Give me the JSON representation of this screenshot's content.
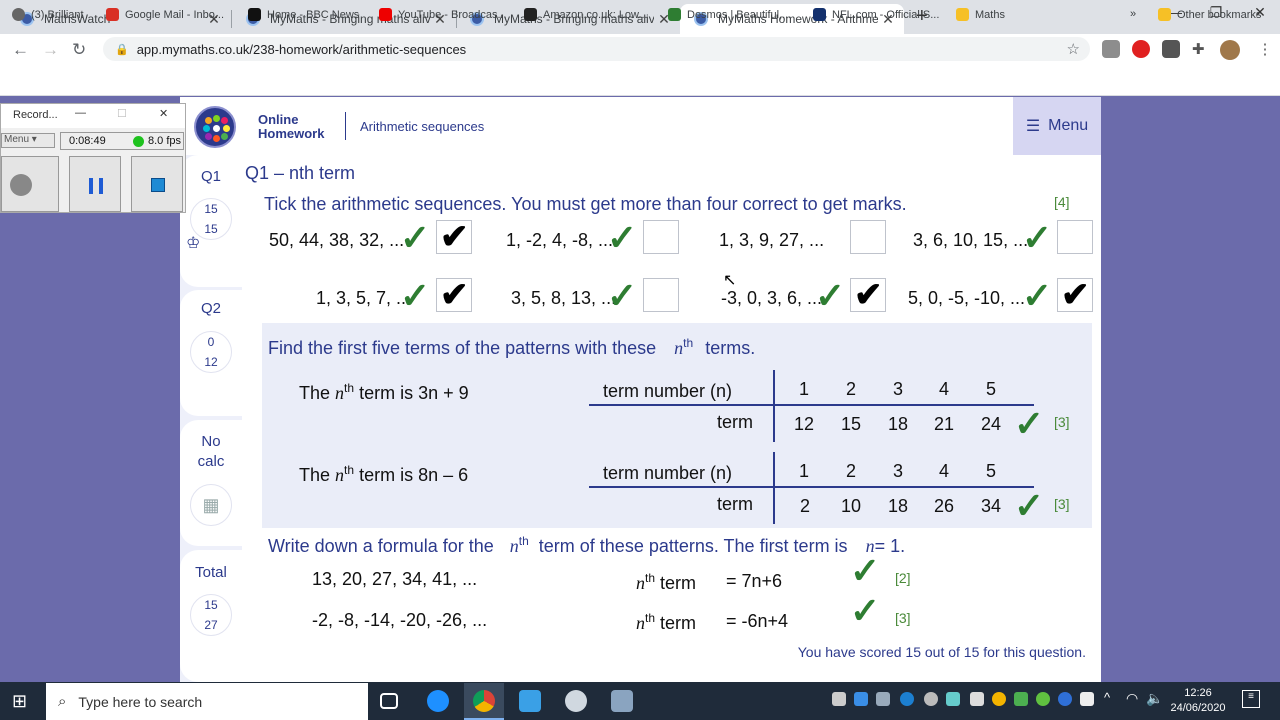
{
  "browser": {
    "tabs": [
      {
        "title": "MathsWatch",
        "active": false
      },
      {
        "title": "MyMaths - Bringing maths alive",
        "active": false
      },
      {
        "title": "MyMaths - Bringing maths alive",
        "active": false
      },
      {
        "title": "MyMaths Homework - Arithmetic",
        "active": true
      }
    ],
    "url": "app.mymaths.co.uk/238-homework/arithmetic-sequences",
    "bookmarks": [
      "(3) Brilliant",
      "Google Mail - Inbo...",
      "Home - BBC News",
      "YouTube - Broadcas...",
      "Amazon.co.uk: Low...",
      "Desmos | Beautiful,...",
      "NFL.com - Official S...",
      "Maths",
      "Other bookmarks"
    ]
  },
  "header": {
    "brand_line1": "Online",
    "brand_line2": "Homework",
    "title": "Arithmetic sequences",
    "menu": "Menu"
  },
  "sidebar": {
    "q1": {
      "label": "Q1",
      "score": "15",
      "max": "15"
    },
    "q2": {
      "label": "Q2",
      "score": "0",
      "max": "12"
    },
    "nocalc": {
      "line1": "No",
      "line2": "calc"
    },
    "total": {
      "label": "Total",
      "score": "15",
      "max": "27"
    }
  },
  "question": {
    "title": "Q1 – nth term",
    "part1": {
      "instruction": "Tick the arithmetic sequences. You must get more than four correct to get marks.",
      "marks": "[4]",
      "sequences": [
        {
          "text": "50, 44, 38, 32, ...",
          "ticked": true
        },
        {
          "text": "1, -2, 4, -8, ...",
          "ticked": false
        },
        {
          "text": "1, 3, 9, 27, ...",
          "ticked": false
        },
        {
          "text": "3, 6, 10, 15, ...",
          "ticked": false
        },
        {
          "text": "1, 3, 5, 7, ...",
          "ticked": true
        },
        {
          "text": "3, 5, 8, 13, ...",
          "ticked": false
        },
        {
          "text": "-3, 0, 3, 6, ...",
          "ticked": true
        },
        {
          "text": "5, 0, -5, -10, ...",
          "ticked": true
        }
      ]
    },
    "part2": {
      "instruction_a": "Find the first five terms of the patterns with these",
      "instruction_b": "terms.",
      "n": "n",
      "th": "th",
      "tables": [
        {
          "rule_prefix": "The",
          "rule_suffix": "term is 3n + 9",
          "header": "term number (n)",
          "numbers": [
            "1",
            "2",
            "3",
            "4",
            "5"
          ],
          "row_label": "term",
          "terms": [
            "12",
            "15",
            "18",
            "21",
            "24"
          ],
          "marks": "[3]"
        },
        {
          "rule_prefix": "The",
          "rule_suffix": "term is 8n – 6",
          "header": "term number (n)",
          "numbers": [
            "1",
            "2",
            "3",
            "4",
            "5"
          ],
          "row_label": "term",
          "terms": [
            "2",
            "10",
            "18",
            "26",
            "34"
          ],
          "marks": "[3]"
        }
      ]
    },
    "part3": {
      "instruction_a": "Write down a formula for the",
      "instruction_b": "term of these patterns. The first term is",
      "instruction_c": "= 1.",
      "rows": [
        {
          "sequence": "13, 20, 27, 34, 41, ...",
          "label": "term",
          "answer": "=  7n+6",
          "marks": "[2]"
        },
        {
          "sequence": "-2, -8, -14, -20, -26, ...",
          "label": "term",
          "answer": "=  -6n+4",
          "marks": "[3]"
        }
      ]
    },
    "feedback": "You have scored 15 out of 15 for this question."
  },
  "recorder": {
    "title": "Record...",
    "menu": "Menu",
    "time": "0:08:49",
    "fps": "8.0 fps"
  },
  "taskbar": {
    "search_placeholder": "Type here to search",
    "time": "12:26",
    "date": "24/06/2020"
  }
}
